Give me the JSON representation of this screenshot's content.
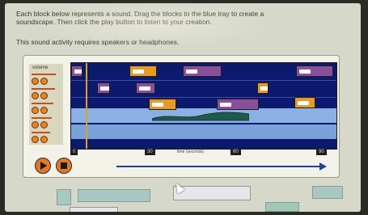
{
  "instructions": {
    "line1": "Each block below represents a sound. Drag the blocks to the blue tray to create a",
    "line2": "soundscape. Then click the play button to listen to your creation.",
    "note": "This sound activity requires speakers or headphones."
  },
  "mixer": {
    "volume_label": "volume",
    "tracks": [
      {
        "level": 0.8
      },
      {
        "level": 0.75
      },
      {
        "level": 0.7
      },
      {
        "level": 0.65
      },
      {
        "level": 0.6
      }
    ]
  },
  "timeline": {
    "ticks": [
      "0",
      "30",
      "60",
      "90"
    ],
    "axis_label": "time (seconds)"
  },
  "colors": {
    "track_background": "#0b1a6d",
    "bottom_lane": "#8ab0e4",
    "accent_orange": "#e89a26",
    "block_purple": "#8a4f9a",
    "arrow_blue": "#22409a"
  },
  "icons": {
    "play": "play-icon",
    "stop": "stop-icon"
  }
}
